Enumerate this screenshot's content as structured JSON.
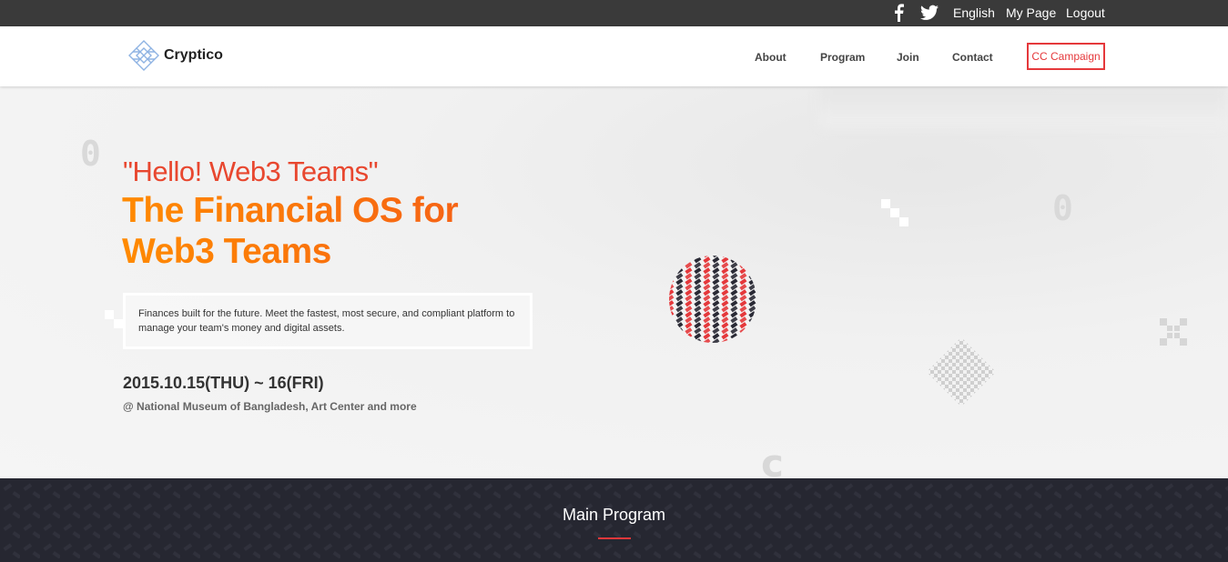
{
  "topbar": {
    "language": "English",
    "mypage": "My Page",
    "logout": "Logout",
    "icons": [
      "facebook-icon",
      "twitter-icon"
    ]
  },
  "header": {
    "logo_text": "Cryptico",
    "nav": {
      "about": "About",
      "program": "Program",
      "join": "Join",
      "contact": "Contact",
      "campaign": "CC Campaign"
    }
  },
  "hero": {
    "subtitle": "\"Hello! Web3 Teams\"",
    "title": "The Financial OS for Web3 Teams",
    "description": "Finances built for the future. Meet the fastest, most secure, and compliant platform to manage your team's money and digital assets.",
    "date": "2015.10.15(THU) ~ 16(FRI)",
    "venue": "@ National Museum of Bangladesh, Art Center and more",
    "deco_zero": "0",
    "deco_c": "c"
  },
  "program": {
    "title": "Main Program"
  },
  "colors": {
    "accent_red": "#e5383b",
    "orange": "#ff8a00",
    "dark": "#262731",
    "topbar": "#3a3a3a"
  }
}
